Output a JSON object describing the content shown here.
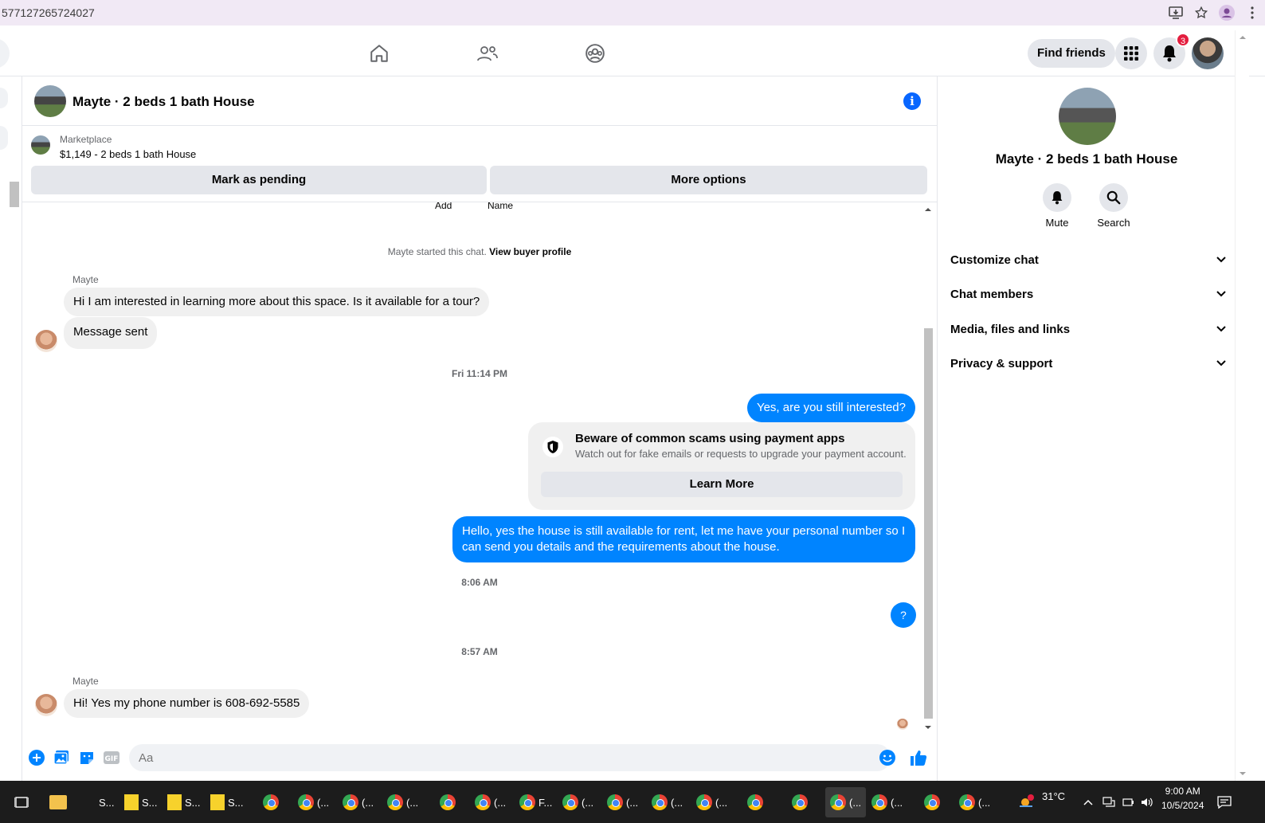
{
  "browser": {
    "url": "577127265724027"
  },
  "header": {
    "find_friends": "Find friends",
    "notification_count": "3"
  },
  "chat": {
    "title": "Mayte · 2 beds 1 bath House",
    "marketplace_label": "Marketplace",
    "listing": "$1,149 - 2 beds 1 bath House",
    "mark_pending": "Mark as pending",
    "more_options": "More options",
    "top_cut_labels": [
      "Add",
      "Name"
    ],
    "started_text": "Mayte started this chat.",
    "view_profile": "View buyer profile",
    "sender_1": "Mayte",
    "msg_1": "Hi I am interested in learning more about this space. Is it available for a tour?",
    "msg_2": "Message sent",
    "time_1": "Fri 11:14 PM",
    "out_1": "Yes, are you still interested?",
    "scam_title": "Beware of common scams using payment apps",
    "scam_desc": "Watch out for fake emails or requests to upgrade your payment account.",
    "learn_more": "Learn More",
    "out_2": "Hello, yes the house is still available for rent, let me have your personal number so I can send you details and the requirements about the house.",
    "time_2": "8:06 AM",
    "out_3": "?",
    "time_3": "8:57 AM",
    "sender_2": "Mayte",
    "msg_3": "Hi! Yes my phone number is 608-692-5585",
    "composer_placeholder": "Aa"
  },
  "panel": {
    "name": "Mayte · 2 beds 1 bath House",
    "mute": "Mute",
    "search": "Search",
    "rows": [
      "Customize chat",
      "Chat members",
      "Media, files and links",
      "Privacy & support"
    ]
  },
  "taskbar": {
    "items": [
      "S...",
      "S...",
      "S...",
      "S...",
      "(...",
      "(...",
      "(...",
      "F...",
      "(...",
      "(...",
      "(...",
      "(...",
      "(...",
      "(...",
      "(..."
    ],
    "temperature": "31°C",
    "time": "9:00 AM",
    "date": "10/5/2024"
  },
  "colors": {
    "accent": "#0084ff",
    "brand": "#0866ff",
    "bubble_in": "#f0f0f0"
  }
}
